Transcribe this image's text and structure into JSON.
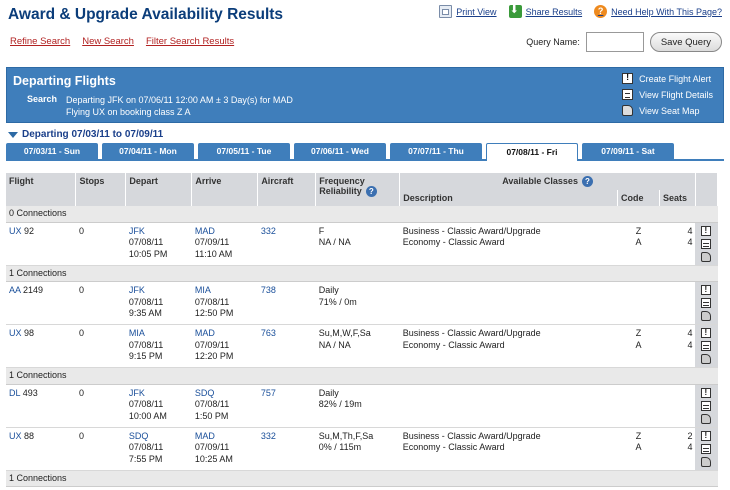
{
  "header": {
    "title": "Award & Upgrade Availability Results",
    "links": [
      {
        "label": "Print View",
        "icon": "print-icon"
      },
      {
        "label": "Share Results",
        "icon": "share-icon"
      },
      {
        "label": "Need Help With This Page?",
        "icon": "help-icon"
      }
    ],
    "sub_links": [
      "Refine Search",
      "New Search",
      "Filter Search Results"
    ],
    "query_label": "Query Name:",
    "query_value": "",
    "save_label": "Save Query"
  },
  "panel": {
    "title": "Departing Flights",
    "search_label": "Search",
    "search_line1": "Departing JFK on 07/06/11 12:00 AM ± 3 Day(s) for MAD",
    "search_line2": "Flying UX on booking class Z A",
    "actions": [
      "Create Flight Alert",
      "View Flight Details",
      "View Seat Map"
    ]
  },
  "range_label": "Departing 07/03/11 to 07/09/11",
  "tabs": [
    {
      "label": "07/03/11 - Sun",
      "active": false
    },
    {
      "label": "07/04/11 - Mon",
      "active": false
    },
    {
      "label": "07/05/11 - Tue",
      "active": false
    },
    {
      "label": "07/06/11 - Wed",
      "active": false
    },
    {
      "label": "07/07/11 - Thu",
      "active": false
    },
    {
      "label": "07/08/11 - Fri",
      "active": true
    },
    {
      "label": "07/09/11 - Sat",
      "active": false
    }
  ],
  "table": {
    "headers": {
      "flight": "Flight",
      "stops": "Stops",
      "depart": "Depart",
      "arrive": "Arrive",
      "aircraft": "Aircraft",
      "frequency": "Frequency",
      "reliability": "Reliability",
      "available": "Available Classes",
      "description": "Description",
      "code": "Code",
      "seats": "Seats"
    },
    "rows": [
      {
        "type": "conn",
        "label": "0 Connections"
      },
      {
        "type": "flight",
        "airline": "UX",
        "num": "92",
        "stops": "0",
        "dep_code": "JFK",
        "dep_date": "07/08/11",
        "dep_time": "10:05 PM",
        "arr_code": "MAD",
        "arr_date": "07/09/11",
        "arr_time": "11:10 AM",
        "aircraft": "332",
        "freq": "F",
        "rel": "NA / NA",
        "desc": [
          "Business - Classic Award/Upgrade",
          "Economy - Classic Award"
        ],
        "codes": [
          "Z",
          "A"
        ],
        "seats": [
          "4",
          "4"
        ]
      },
      {
        "type": "conn",
        "label": "1 Connections"
      },
      {
        "type": "flight",
        "airline": "AA",
        "num": "2149",
        "stops": "0",
        "dep_code": "JFK",
        "dep_date": "07/08/11",
        "dep_time": "9:35 AM",
        "arr_code": "MIA",
        "arr_date": "07/08/11",
        "arr_time": "12:50 PM",
        "aircraft": "738",
        "freq": "Daily",
        "rel": "71% / 0m",
        "desc": [],
        "codes": [],
        "seats": []
      },
      {
        "type": "flight",
        "airline": "UX",
        "num": "98",
        "stops": "0",
        "dep_code": "MIA",
        "dep_date": "07/08/11",
        "dep_time": "9:15 PM",
        "arr_code": "MAD",
        "arr_date": "07/09/11",
        "arr_time": "12:20 PM",
        "aircraft": "763",
        "freq": "Su,M,W,F,Sa",
        "rel": "NA / NA",
        "desc": [
          "Business - Classic Award/Upgrade",
          "Economy - Classic Award"
        ],
        "codes": [
          "Z",
          "A"
        ],
        "seats": [
          "4",
          "4"
        ]
      },
      {
        "type": "conn",
        "label": "1 Connections"
      },
      {
        "type": "flight",
        "airline": "DL",
        "num": "493",
        "stops": "0",
        "dep_code": "JFK",
        "dep_date": "07/08/11",
        "dep_time": "10:00 AM",
        "arr_code": "SDQ",
        "arr_date": "07/08/11",
        "arr_time": "1:50 PM",
        "aircraft": "757",
        "freq": "Daily",
        "rel": "82% / 19m",
        "desc": [],
        "codes": [],
        "seats": []
      },
      {
        "type": "flight",
        "airline": "UX",
        "num": "88",
        "stops": "0",
        "dep_code": "SDQ",
        "dep_date": "07/08/11",
        "dep_time": "7:55 PM",
        "arr_code": "MAD",
        "arr_date": "07/09/11",
        "arr_time": "10:25 AM",
        "aircraft": "332",
        "freq": "Su,M,Th,F,Sa",
        "rel": "0% / 115m",
        "desc": [
          "Business - Classic Award/Upgrade",
          "Economy - Classic Award"
        ],
        "codes": [
          "Z",
          "A"
        ],
        "seats": [
          "2",
          "4"
        ]
      },
      {
        "type": "conn",
        "label": "1 Connections"
      }
    ]
  }
}
